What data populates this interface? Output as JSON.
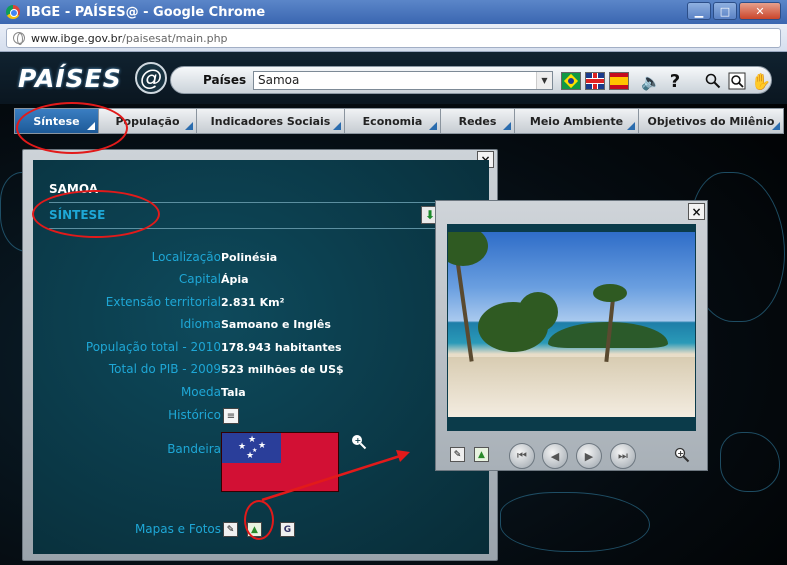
{
  "window": {
    "title": "IBGE - PAÍSES@ - Google Chrome",
    "buttons": {
      "minimize": "▁",
      "maximize": "□",
      "close": "✕"
    }
  },
  "addressbar": {
    "url_host": "www.ibge.gov.br",
    "url_path": "/paisesat/main.php"
  },
  "header": {
    "logo": "PAÍSES",
    "logo_at": "@",
    "search_label": "Países",
    "selected_country": "Samoa",
    "tool_icons": [
      "speaker-icon",
      "help-icon",
      "search-icon",
      "zoom-icon",
      "hand-icon"
    ],
    "help_glyph": "?"
  },
  "tabs": [
    {
      "label": "Síntese",
      "active": true
    },
    {
      "label": "População"
    },
    {
      "label": "Indicadores Sociais"
    },
    {
      "label": "Economia"
    },
    {
      "label": "Redes"
    },
    {
      "label": "Meio Ambiente"
    },
    {
      "label": "Objetivos do Milênio"
    }
  ],
  "panel": {
    "close": "×",
    "country": "SAMOA",
    "section": "SÍNTESE",
    "rows": [
      {
        "label": "Localização",
        "value": "Polinésia"
      },
      {
        "label": "Capital",
        "value": "Ápia"
      },
      {
        "label": "Extensão territorial",
        "value": "2.831 Km²"
      },
      {
        "label": "Idioma",
        "value": "Samoano e Inglês"
      },
      {
        "label": "População total - 2010",
        "value": "178.943 habitantes"
      },
      {
        "label": "Total do PIB - 2009",
        "value": "523 milhões de US$"
      },
      {
        "label": "Moeda",
        "value": "Tala"
      }
    ],
    "historico_label": "Histórico",
    "bandeira_label": "Bandeira",
    "mapas_label": "Mapas e Fotos",
    "g_glyph": "G"
  },
  "viewer": {
    "close": "×"
  },
  "colors": {
    "accent": "#1ea7d6",
    "annotation": "#e21a1a",
    "tab_active": "#2a6cae"
  }
}
